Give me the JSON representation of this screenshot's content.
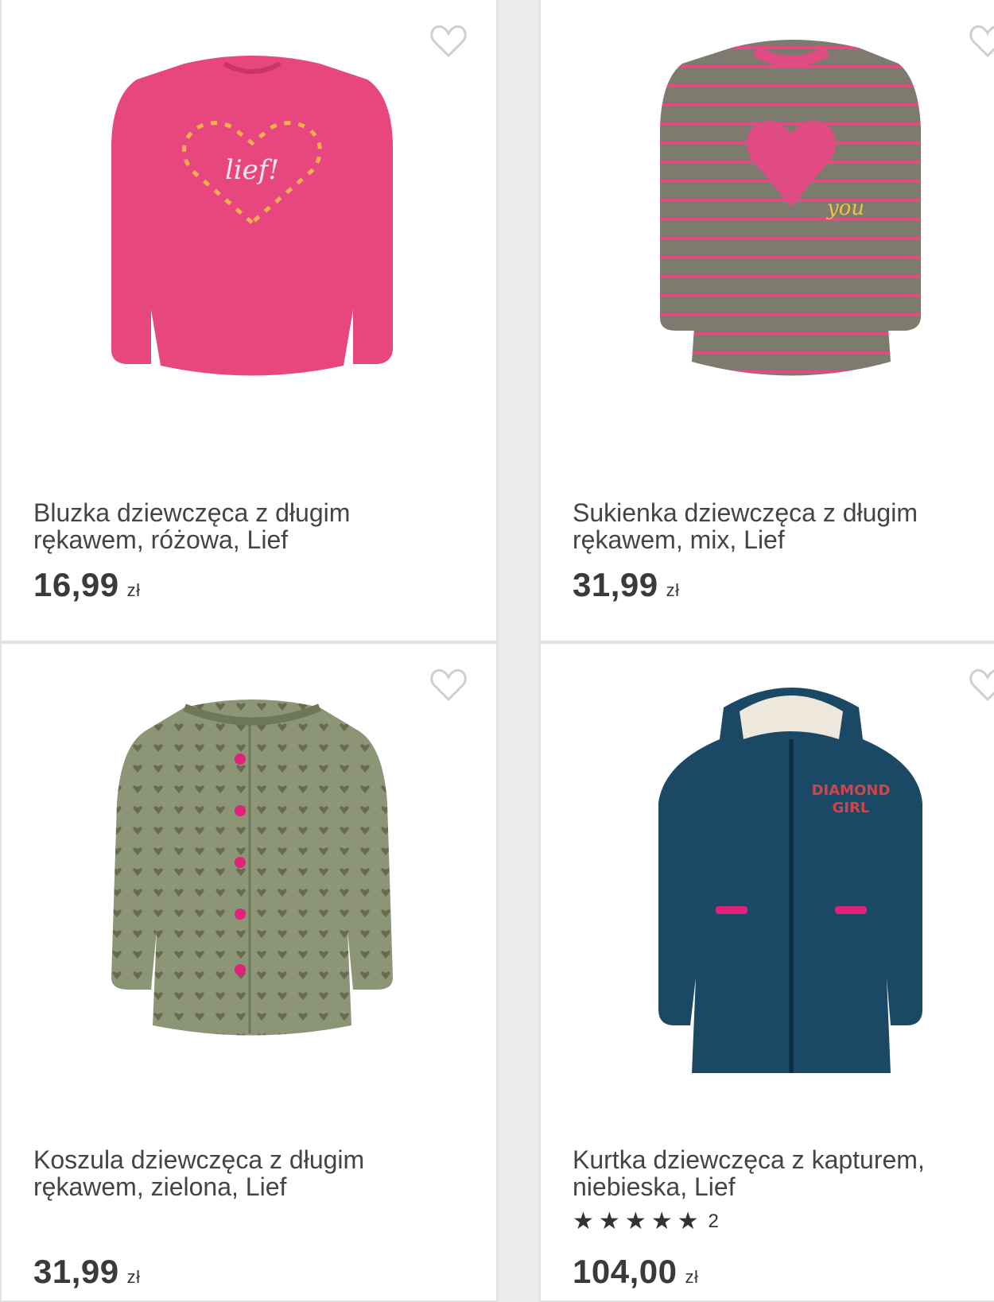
{
  "products": [
    {
      "title": "Bluzka dziewczęca z długim rękawem, różowa, Lief",
      "price": "16,99",
      "currency": "zł",
      "image_icon": "pink-sweatshirt-heart-image"
    },
    {
      "title": "Sukienka dziewczęca z długim rękawem, mix, Lief",
      "price": "31,99",
      "currency": "zł",
      "image_icon": "striped-dress-heart-image"
    },
    {
      "title": "Koszula dziewczęca z długim rękawem, zielona, Lief",
      "price": "31,99",
      "currency": "zł",
      "image_icon": "green-shirt-image"
    },
    {
      "title": "Kurtka dziewczęca z kapturem, niebieska, Lief",
      "price": "104,00",
      "currency": "zł",
      "rating": 5,
      "rating_count": "2",
      "image_icon": "blue-hooded-jacket-image"
    }
  ],
  "colors": {
    "pink_shirt": "#e8467f",
    "stripe_grey": "#7d7a6e",
    "stripe_pink": "#e14b83",
    "olive": "#8c9575",
    "navy": "#1b4864",
    "accent_pink": "#e0227a"
  }
}
